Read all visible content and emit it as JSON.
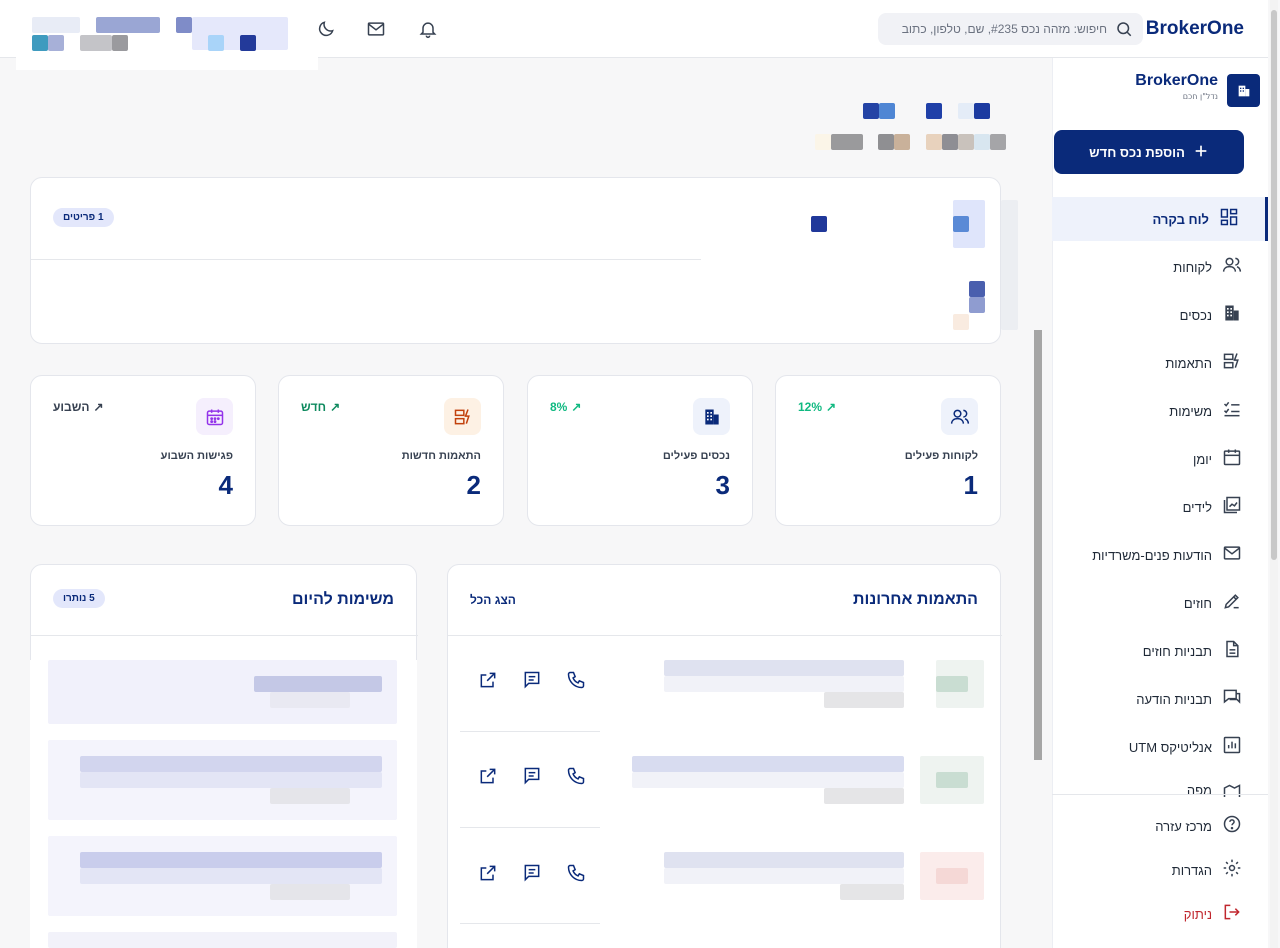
{
  "app": {
    "brand": "BrokerOne",
    "tagline": "נדל\"ן חכם"
  },
  "search": {
    "placeholder": "חיפוש: מזהה נכס #235, שם, טלפון, כתוב"
  },
  "header_icons": [
    "bell-icon",
    "mail-icon",
    "moon-icon"
  ],
  "sidebar": {
    "add_button": "הוספת נכס חדש",
    "items": [
      {
        "label": "לוח בקרה",
        "icon": "dashboard-icon",
        "active": true
      },
      {
        "label": "לקוחות",
        "icon": "users-icon"
      },
      {
        "label": "נכסים",
        "icon": "building-icon"
      },
      {
        "label": "התאמות",
        "icon": "match-icon"
      },
      {
        "label": "משימות",
        "icon": "checklist-icon"
      },
      {
        "label": "יומן",
        "icon": "calendar-icon"
      },
      {
        "label": "לידים",
        "icon": "leads-icon"
      },
      {
        "label": "הודעות פנים-משרדיות",
        "icon": "mail-icon"
      },
      {
        "label": "חוזים",
        "icon": "pen-icon"
      },
      {
        "label": "תבניות חוזים",
        "icon": "document-icon"
      },
      {
        "label": "תבניות הודעה",
        "icon": "chat-icon"
      },
      {
        "label": "אנליטיקס UTM",
        "icon": "analytics-icon"
      },
      {
        "label": "מפה",
        "icon": "map-icon"
      }
    ],
    "footer": [
      {
        "label": "מרכז עזרה",
        "icon": "help-icon"
      },
      {
        "label": "הגדרות",
        "icon": "gear-icon"
      },
      {
        "label": "ניתוק",
        "icon": "logout-icon"
      }
    ]
  },
  "first_card": {
    "badge": "1 פריטים"
  },
  "stats": [
    {
      "label": "לקוחות פעילים",
      "value": "1",
      "trend": "12%",
      "trend_color": "#10b981",
      "icon": "users-icon",
      "icon_bg": "#eef2fb",
      "icon_color": "#0a2a7a"
    },
    {
      "label": "נכסים פעילים",
      "value": "3",
      "trend": "8%",
      "trend_color": "#10b981",
      "icon": "building-icon",
      "icon_bg": "#eef2fb",
      "icon_color": "#0a2a7a"
    },
    {
      "label": "התאמות חדשות",
      "value": "2",
      "trend": "חדש",
      "trend_color": "#0f8a5f",
      "icon": "match-icon",
      "icon_bg": "#fdf1e4",
      "icon_color": "#c2410c"
    },
    {
      "label": "פגישות השבוע",
      "value": "4",
      "trend": "השבוע",
      "trend_color": "#374151",
      "icon": "calendar-icon",
      "icon_bg": "#f5effd",
      "icon_color": "#9333ea"
    }
  ],
  "recent_matches": {
    "title": "התאמות אחרונות",
    "show_all": "הצג הכל"
  },
  "tasks": {
    "title": "משימות להיום",
    "badge": "5 נותרו"
  },
  "colors": {
    "primary": "#0a2a7a",
    "danger": "#c0262d",
    "success": "#10b981"
  }
}
